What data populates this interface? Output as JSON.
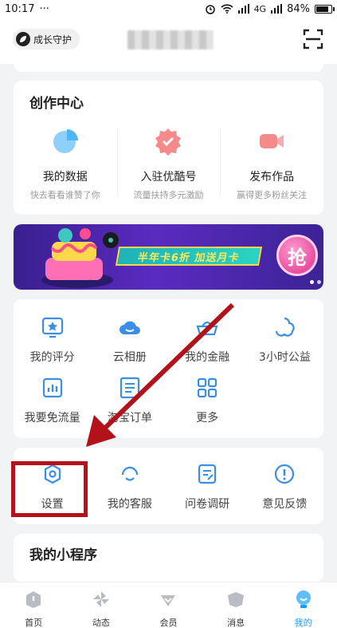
{
  "status_bar": {
    "time": "10:17",
    "dots": "···",
    "network": "4G",
    "battery": "84%"
  },
  "header": {
    "guard_label": "成长守护",
    "icons": {
      "scan": "scan-icon",
      "leaf": "leaf-icon"
    }
  },
  "creation_center": {
    "title": "创作中心",
    "items": [
      {
        "label": "我的数据",
        "sub": "快去看看谁赞了你",
        "icon": "pie-chart-icon",
        "color": "#4fb6f5"
      },
      {
        "label": "入驻优酷号",
        "sub": "流量扶持多元激励",
        "icon": "badge-check-icon",
        "color": "#f26d6d"
      },
      {
        "label": "发布作品",
        "sub": "赢得更多粉丝关注",
        "icon": "video-camera-icon",
        "color": "#f26d6d"
      }
    ]
  },
  "banner": {
    "promo_text": "半年卡6折 加送月卡",
    "grab_label": "抢",
    "colors": {
      "bg": "#4a27a8",
      "badge": "#e02d8b"
    }
  },
  "services": {
    "items": [
      {
        "label": "我的评分",
        "icon": "star-rating-icon"
      },
      {
        "label": "云相册",
        "icon": "cloud-icon"
      },
      {
        "label": "我的金融",
        "icon": "gold-ingot-icon"
      },
      {
        "label": "3小时公益",
        "icon": "charity-icon"
      },
      {
        "label": "我要免流量",
        "icon": "data-chart-icon"
      },
      {
        "label": "淘宝订单",
        "icon": "taobao-order-icon"
      },
      {
        "label": "更多",
        "icon": "grid-more-icon"
      }
    ]
  },
  "support": {
    "items": [
      {
        "label": "设置",
        "icon": "settings-icon"
      },
      {
        "label": "我的客服",
        "icon": "customer-service-icon"
      },
      {
        "label": "问卷调研",
        "icon": "survey-icon"
      },
      {
        "label": "意见反馈",
        "icon": "feedback-icon"
      }
    ]
  },
  "mini_programs": {
    "title": "我的小程序"
  },
  "bottom_nav": {
    "items": [
      {
        "label": "首页",
        "icon": "home-icon"
      },
      {
        "label": "动态",
        "icon": "pinwheel-icon"
      },
      {
        "label": "会员",
        "icon": "vip-diamond-icon"
      },
      {
        "label": "消息",
        "icon": "message-icon"
      },
      {
        "label": "我的",
        "icon": "profile-icon",
        "active": true
      }
    ],
    "active_color": "#1a9cff"
  },
  "annotation": {
    "highlight_color": "#b3121a"
  }
}
